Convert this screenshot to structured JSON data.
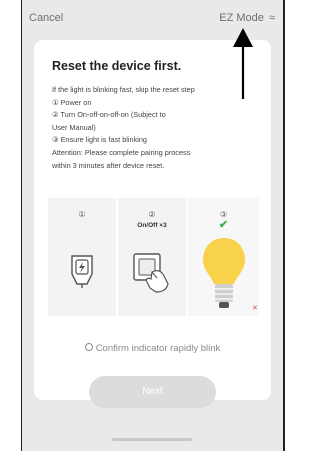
{
  "topbar": {
    "cancel_label": "Cancel",
    "mode_label": "EZ Mode",
    "mode_icon": "wifi-icon"
  },
  "card": {
    "title": "Reset the device first.",
    "steps": [
      "If the light is blinking fast, skip the reset step",
      "① Power on",
      "② Turn On-off-on-off-on (Subject to",
      "User Manual)",
      "③ Ensure light is fast blinking",
      "Attention: Please complete pairing process",
      "within 3 minutes after device reset."
    ],
    "illustration": {
      "step1_number": "①",
      "step2_number": "②",
      "step2_caption": "On/Off ×3",
      "step3_number": "③",
      "step3_check": "✔"
    },
    "confirm_label": "Confirm indicator rapidly blink",
    "next_label": "Next"
  },
  "colors": {
    "accent_green": "#3cb04a",
    "bulb_yellow": "#f7d24a",
    "button_disabled": "#dcdcdc"
  }
}
